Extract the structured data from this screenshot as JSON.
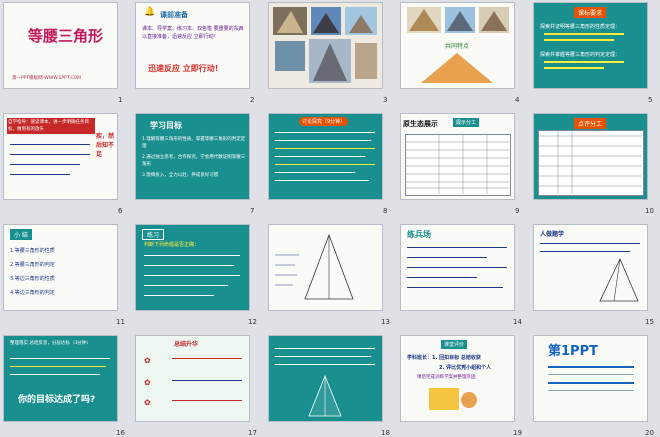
{
  "slides": [
    {
      "num": "1",
      "title": "等腰三角形",
      "footer": "第一PPT模板网-WWW.1PPT.COM"
    },
    {
      "num": "2",
      "title": "课前准备",
      "body": "课本、导学案、练习本、双色笔 要重要的东西以直接准备，迅速反应 立即行动！",
      "slogan": "迅速反应  立即行动!"
    },
    {
      "num": "3"
    },
    {
      "num": "4",
      "caption": "共同特点"
    },
    {
      "num": "5",
      "badge": "课标要求",
      "line1": "探索并证明等腰三角形的性质定理：",
      "line2": "探索并掌握等腰三角形的判定定理："
    },
    {
      "num": "6",
      "lead": "自学指导：速读课本，进一步明确任务目标，做到有的放矢",
      "side": "疾，然后知不足"
    },
    {
      "num": "7",
      "title": "学习目标",
      "item1": "1.理解等腰三角形的性质。掌握等腰三角形的判定定理",
      "item2": "2.通过独立思考，合作探究，学会用代数证明等腰三角形",
      "item3": "3.激情投入，全力以赴，养成良好习惯"
    },
    {
      "num": "8",
      "title": "讨论探究（9分钟）"
    },
    {
      "num": "9",
      "title": "原生态展示",
      "badge": "展示分工"
    },
    {
      "num": "10",
      "badge": "点评分工"
    },
    {
      "num": "11",
      "tag": "小 结",
      "item1": "1.等腰三角形的性质",
      "item2": "2.等腰三角形的判定",
      "item3": "3.等边三角形的性质",
      "item4": "4.等边三角形的判定"
    },
    {
      "num": "12",
      "tag": "练习",
      "prompt": "判断下列命题是否正确："
    },
    {
      "num": "13"
    },
    {
      "num": "14",
      "title": "练兵场"
    },
    {
      "num": "15",
      "title": "人做题学"
    },
    {
      "num": "16",
      "head": "整理落实 总结反思，分层达标（3分钟）",
      "question": "你的目标达成了吗?"
    },
    {
      "num": "17",
      "title": "总结升华"
    },
    {
      "num": "18"
    },
    {
      "num": "19",
      "badge": "课堂评价",
      "line1": "学科班长：1. 回扣目标 总结收获",
      "line2": "2. 评比优秀小组和个人",
      "line3": "课后完成训练学案并整理巩固"
    },
    {
      "num": "20",
      "logo": "第1PPT"
    }
  ]
}
